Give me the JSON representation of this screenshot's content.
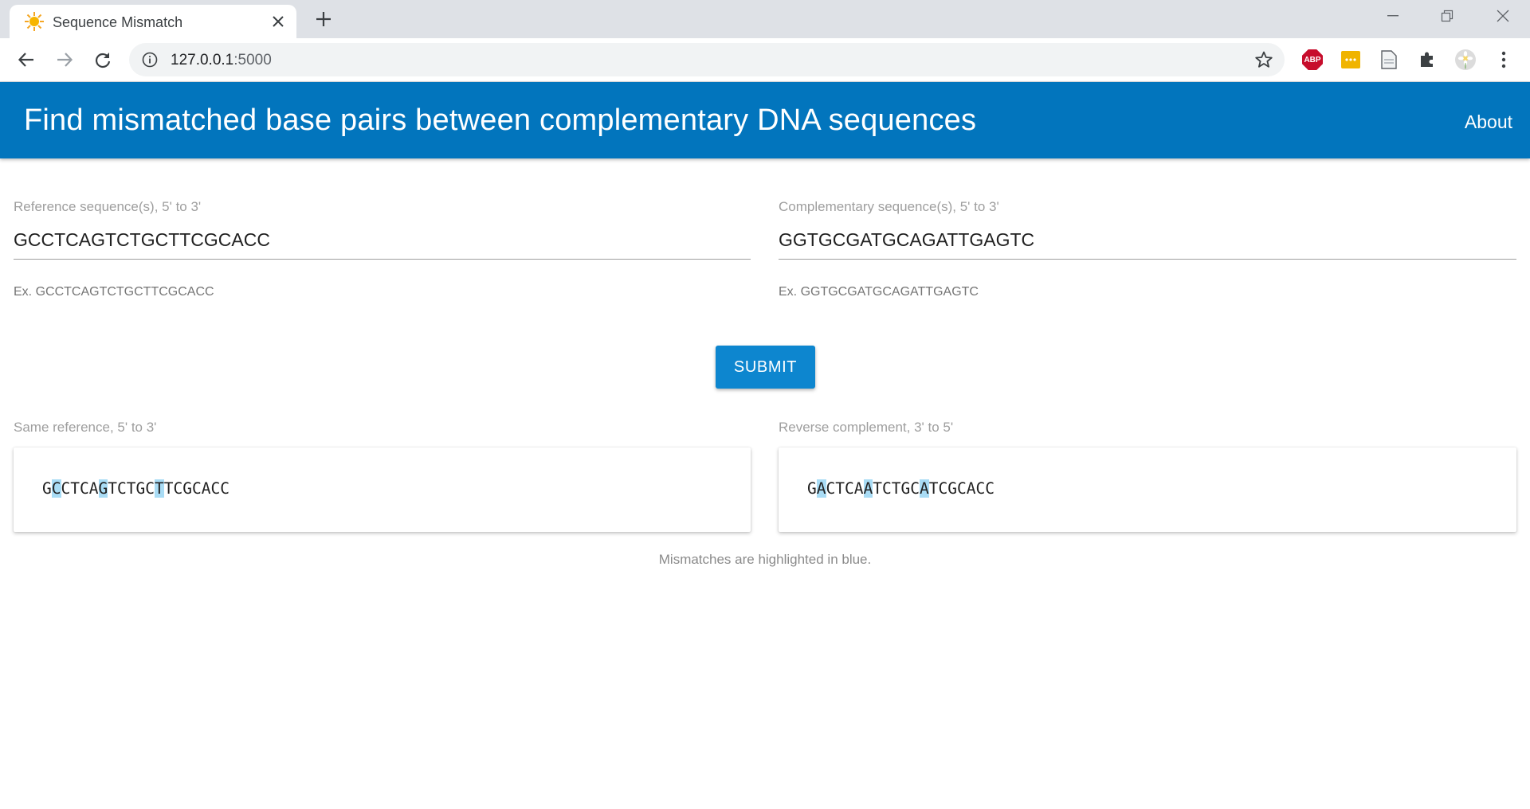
{
  "browser": {
    "tab_title": "Sequence Mismatch",
    "url_host": "127.0.0.1",
    "url_port": ":5000",
    "extensions": {
      "abp_label": "ABP"
    }
  },
  "header": {
    "title": "Find mismatched base pairs between complementary DNA sequences",
    "about_label": "About"
  },
  "form": {
    "reference": {
      "label": "Reference sequence(s), 5' to 3'",
      "value": "GCCTCAGTCTGCTTCGCACC",
      "helper": "Ex. GCCTCAGTCTGCTTCGCACC"
    },
    "complement": {
      "label": "Complementary sequence(s), 5' to 3'",
      "value": "GGTGCGATGCAGATTGAGTC",
      "helper": "Ex. GGTGCGATGCAGATTGAGTC"
    },
    "submit_label": "SUBMIT"
  },
  "results": {
    "reference_label": "Same reference, 5' to 3'",
    "reference_sequence": "GCCTCAGTCTGCTTCGCACC",
    "reference_mismatches": [
      1,
      6,
      12
    ],
    "complement_label": "Reverse complement, 3' to 5'",
    "complement_sequence": "GACTCAATCTGCATCGCACC",
    "complement_mismatches": [
      1,
      6,
      12
    ],
    "highlight_color": "#a9dcf5",
    "footnote": "Mismatches are highlighted in blue."
  },
  "colors": {
    "appbar": "#0275bd",
    "button": "#0d86cf"
  }
}
